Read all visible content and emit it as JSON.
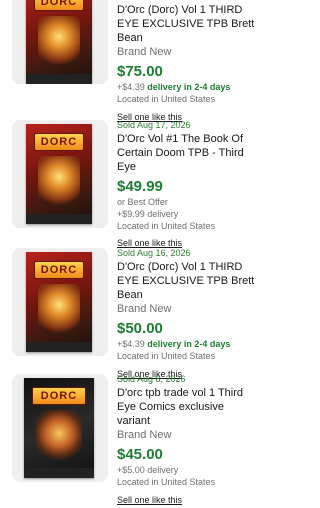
{
  "listings": [
    {
      "sold": "",
      "title": "D'Orc (Dorc) Vol 1 THIRD EYE EXCLUSIVE TPB Brett Bean",
      "condition": "Brand New",
      "price": "$75.00",
      "shipping_cost": "+$4.39",
      "shipping_delivery": "delivery in 2-4 days",
      "location": "Located in United States",
      "sell_link": "Sell one like this",
      "thumb_logo": "DORC"
    },
    {
      "sold": "Sold  Aug 17, 2026",
      "title": "D'Orc Vol #1 The Book Of Certain Doom TPB - Third Eye",
      "condition": "",
      "price": "$49.99",
      "best_offer": "or Best Offer",
      "shipping_cost": "+$9.99 delivery",
      "location": "Located in United States",
      "sell_link": "Sell one like this",
      "thumb_logo": "DORC"
    },
    {
      "sold": "Sold  Aug 16, 2026",
      "title": "D'Orc (Dorc) Vol 1 THIRD EYE EXCLUSIVE TPB Brett Bean",
      "condition": "Brand New",
      "price": "$50.00",
      "shipping_cost": "+$4.39",
      "shipping_delivery": "delivery in 2-4 days",
      "location": "Located in United States",
      "sell_link": "Sell one like this",
      "thumb_logo": "DORC"
    },
    {
      "sold": "Sold  Aug 8, 2026",
      "title": "D'orc tpb trade vol 1 Third Eye Comics exclusive variant",
      "condition": "Brand New",
      "price": "$45.00",
      "shipping_cost": "+$5.00 delivery",
      "location": "Located in United States",
      "sell_link": "Sell one like this",
      "thumb_logo": "DORC"
    }
  ]
}
